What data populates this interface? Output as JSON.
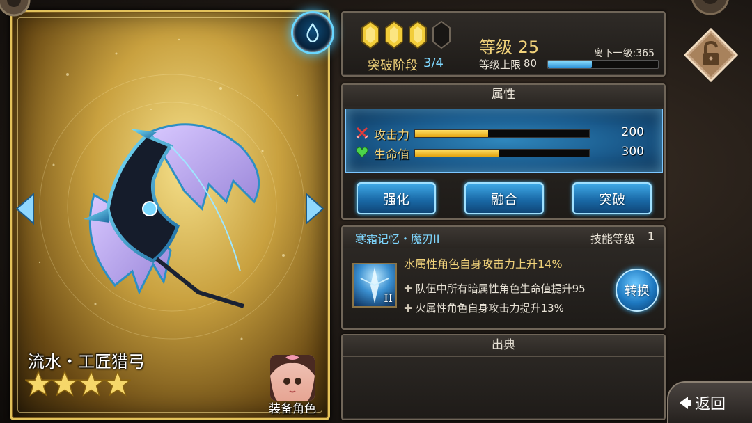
{
  "weapon": {
    "name": "流水・工匠猎弓",
    "rarity_stars": 4,
    "element_icon": "water-drop-icon",
    "equip_label": "装备角色"
  },
  "breakthrough": {
    "gems_total": 4,
    "gems_filled": 3,
    "label": "突破阶段",
    "value": "3/4"
  },
  "level": {
    "label": "等级 25",
    "cap_label": "等级上限",
    "cap_value": "80",
    "next_label": "离下一级:365",
    "progress": 0.4
  },
  "attributes": {
    "title": "属性",
    "stats": [
      {
        "name": "攻击力",
        "value": "200",
        "fill": 0.42,
        "icon": "crossed-swords-icon"
      },
      {
        "name": "生命值",
        "value": "300",
        "fill": 0.48,
        "icon": "heart-icon"
      }
    ],
    "buttons": [
      "强化",
      "融合",
      "突破"
    ]
  },
  "skill": {
    "name": "寒霜记忆・魔刃II",
    "level_label": "技能等级",
    "level_value": "1",
    "icon_numeral": "II",
    "main_effect": "水属性角色自身攻击力上升14%",
    "sub_effects": [
      "队伍中所有暗属性角色生命值提升95",
      "火属性角色自身攻击力提升13%"
    ],
    "switch_label": "转换"
  },
  "source": {
    "title": "出典"
  },
  "nav": {
    "back_label": "返回",
    "lock_icon": "unlock-icon"
  },
  "colors": {
    "gold": "#f1d27a",
    "cyan": "#7fd7ff",
    "button_blue": "#1a6aa8"
  }
}
